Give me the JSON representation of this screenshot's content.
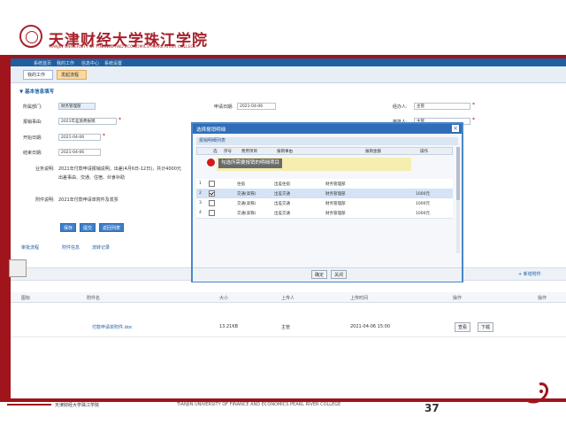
{
  "header": {
    "logo_cn": "天津财经大学珠江学院",
    "logo_en": "TIANJIN UNIVERSITY OF FINANCE AND ECONOMICS PEARL RIVER COLLEGE"
  },
  "navbar": {
    "items": [
      "系统首页",
      "我的工作",
      "信息中心",
      "系统设置"
    ]
  },
  "tabs": [
    {
      "label": "我的工作"
    },
    {
      "label": "发起流程"
    }
  ],
  "form": {
    "section_title": "▼ 基本信息填写",
    "fields": [
      {
        "label": "所属部门:",
        "value": "财务管理部"
      },
      {
        "label": "申请日期:",
        "value": "2021-04-06"
      },
      {
        "label": "报销事由:",
        "value": "2021年差旅费报销"
      },
      {
        "label": "开始日期:",
        "value": "2021-04-06"
      },
      {
        "label": "结束日期:",
        "value": "2021-04-06"
      },
      {
        "label": "经办人:",
        "value": "主管"
      },
      {
        "label": "审批人:",
        "value": "主管"
      }
    ],
    "desc_label": "业务说明:",
    "desc_text_1": "2021年付款申请报销说明，出差(4月6日-12日)，共计4000元",
    "desc_text_2": "出差事由、交通、住宿、伙食补助",
    "attach_label": "附件说明:",
    "attach_text": "2021年付款申请单附件及发票",
    "buttons": {
      "save": "保存",
      "submit": "提交",
      "back": "返回列表"
    }
  },
  "subtabs": [
    "审批流程",
    "附件信息",
    "流转记录"
  ],
  "toolbar": {
    "add_label": "+ 新增附件"
  },
  "table": {
    "headers": [
      "图标",
      "附件名",
      "大小",
      "上传人",
      "上传时间",
      "操作",
      "操作"
    ],
    "row": {
      "name": "付款申请单附件.doc",
      "size": "13.21KB",
      "uploader": "主管",
      "time": "2021-04-06 15:00",
      "actions": [
        "查看",
        "下载"
      ]
    }
  },
  "modal": {
    "title": "选择报销明细",
    "subtitle": "报销明细列表",
    "columns": [
      "选",
      "序号",
      "费用项目",
      "报销事由",
      "报销金额",
      "操作"
    ],
    "rows": [
      {
        "no": "1",
        "checked": false,
        "item": "住宿",
        "reason": "出差住宿",
        "dept": "财务管理部",
        "extra": "",
        "amount": ""
      },
      {
        "no": "2",
        "checked": true,
        "item": "交通(高铁)",
        "reason": "出差交通",
        "dept": "财务管理部",
        "extra": "",
        "amount": "1000元"
      },
      {
        "no": "3",
        "checked": false,
        "item": "交通(高铁)",
        "reason": "出差交通",
        "dept": "财务管理部",
        "extra": "",
        "amount": "1000元"
      },
      {
        "no": "4",
        "checked": false,
        "item": "交通(高铁)",
        "reason": "出差交通",
        "dept": "财务管理部",
        "extra": "",
        "amount": "1000元"
      }
    ],
    "confirm": "确定",
    "cancel": "关闭"
  },
  "tooltip": "勾选所需要报销的明细项目",
  "footer": {
    "cn": "天津财经大学珠江学院",
    "en": "TIANJIN UNIVERSITY OF FINANCE AND ECONOMICS PEARL RIVER COLLEGE",
    "page": "37"
  },
  "colors": {
    "brand_red": "#a0141c",
    "blue": "#2f6db8",
    "alert": "#d41a1a"
  }
}
